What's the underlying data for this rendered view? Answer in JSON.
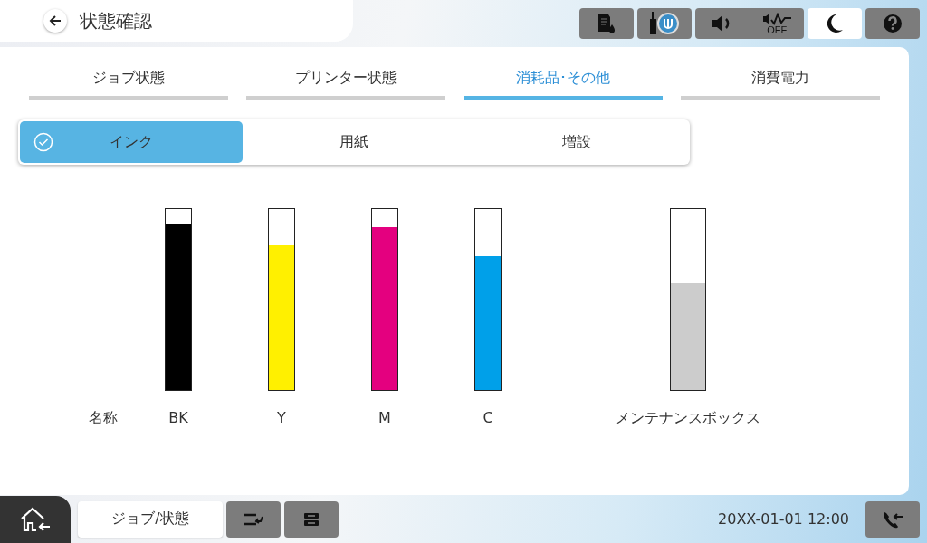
{
  "header": {
    "title": "状態確認"
  },
  "toolbar": {
    "night_mode_on": true,
    "quiet_mode_label": "OFF"
  },
  "tabs": [
    {
      "label": "ジョブ状態",
      "selected": false
    },
    {
      "label": "プリンター状態",
      "selected": false
    },
    {
      "label": "消耗品･その他",
      "selected": true
    },
    {
      "label": "消費電力",
      "selected": false
    }
  ],
  "segments": [
    {
      "label": "インク",
      "selected": true
    },
    {
      "label": "用紙",
      "selected": false
    },
    {
      "label": "増設",
      "selected": false
    }
  ],
  "name_heading": "名称",
  "inks": [
    {
      "name": "BK",
      "level": 0.92,
      "color": "#000000"
    },
    {
      "name": "Y",
      "level": 0.8,
      "color": "#fff000"
    },
    {
      "name": "M",
      "level": 0.9,
      "color": "#e4007f"
    },
    {
      "name": "C",
      "level": 0.74,
      "color": "#00a0e9"
    }
  ],
  "maintenance_box": {
    "name": "メンテナンスボックス",
    "level": 0.59
  },
  "bottom_bar": {
    "job_status_button": "ジョブ/状態",
    "datetime": "20XX-01-01 12:00"
  }
}
